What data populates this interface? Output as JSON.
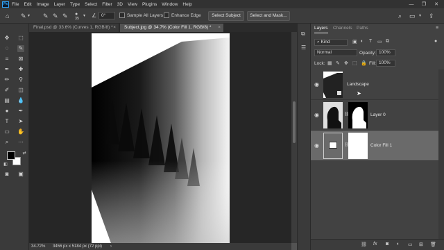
{
  "menu": {
    "logo": "Ps",
    "items": [
      "File",
      "Edit",
      "Image",
      "Layer",
      "Type",
      "Select",
      "Filter",
      "3D",
      "View",
      "Plugins",
      "Window",
      "Help"
    ],
    "window_controls": [
      "—",
      "❐",
      "✕"
    ]
  },
  "options": {
    "brush_size": "35",
    "angle": "0°",
    "sample_all_layers": "Sample All Layers",
    "enhance_edge": "Enhance Edge",
    "select_subject": "Select Subject",
    "select_and_mask": "Select and Mask..."
  },
  "tabs": [
    {
      "label": "Final.psd @ 33.6% (Curves 1, RGB/8) *",
      "active": false
    },
    {
      "label": "Subject.jpg @ 34.7% (Color Fill 1, RGB/8) *",
      "active": true
    }
  ],
  "status": {
    "zoom": "34.72%",
    "doc_info": "3456 px x 5184 px (72 ppi)"
  },
  "layers_panel": {
    "tabs": [
      "Layers",
      "Channels",
      "Paths"
    ],
    "filter_kind": "Kind",
    "blend_mode": "Normal",
    "opacity_label": "Opacity:",
    "opacity_value": "100%",
    "lock_label": "Lock:",
    "fill_label": "Fill:",
    "fill_value": "100%",
    "layers": [
      {
        "name": "Landscape",
        "selected": false
      },
      {
        "name": "Layer 0",
        "selected": false
      },
      {
        "name": "Color Fill 1",
        "selected": true
      }
    ],
    "footer_icons": [
      "link-icon",
      "fx-icon",
      "mask-icon",
      "adjustment-icon",
      "group-icon",
      "new-layer-icon",
      "trash-icon"
    ],
    "footer_fx": "fx"
  },
  "colors": {
    "accent": "#31a8ff",
    "selected_row": "#6a6a6a",
    "panel_bg": "#424242",
    "canvas_bg": "#262626"
  }
}
